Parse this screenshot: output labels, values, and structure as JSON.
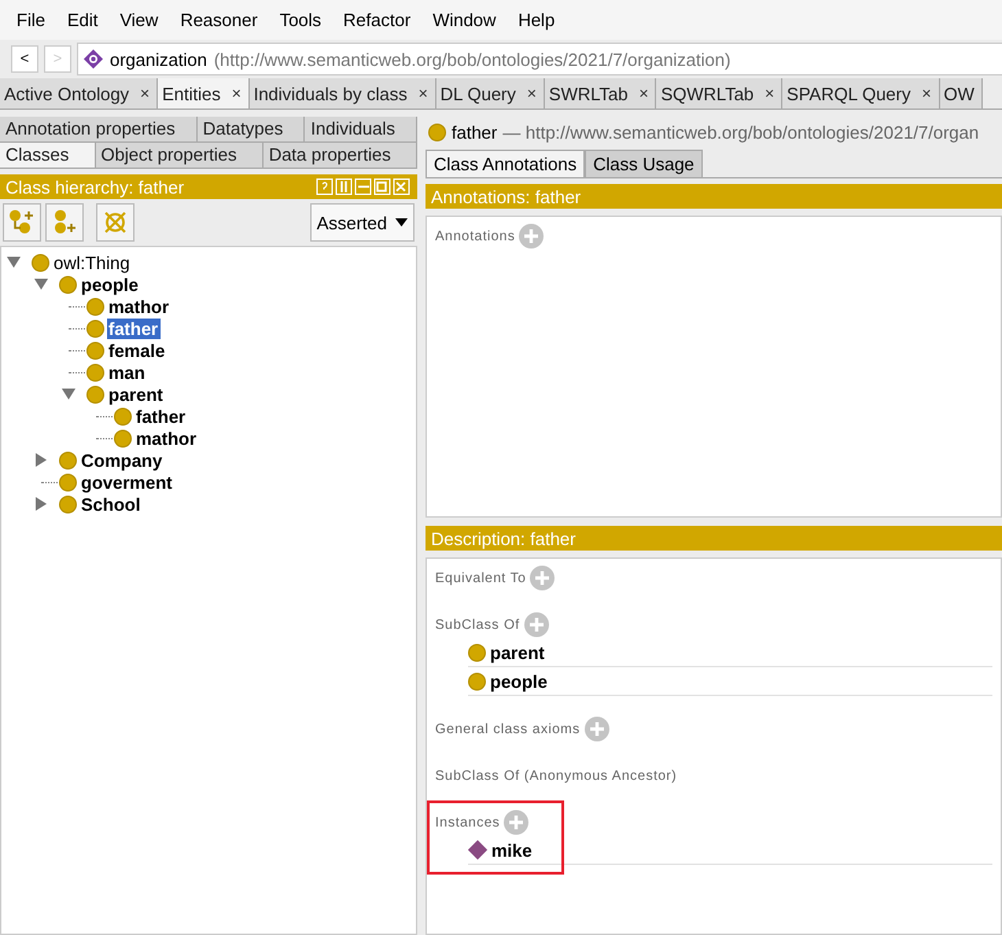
{
  "menu": [
    "File",
    "Edit",
    "View",
    "Reasoner",
    "Tools",
    "Refactor",
    "Window",
    "Help"
  ],
  "nav": {
    "back": "<",
    "forward": ">",
    "ontology": "organization",
    "iri": "(http://www.semanticweb.org/bob/ontologies/2021/7/organization)"
  },
  "tabs": [
    {
      "label": "Active Ontology",
      "selected": false,
      "close": "×"
    },
    {
      "label": "Entities",
      "selected": true,
      "close": "×"
    },
    {
      "label": "Individuals by class",
      "selected": false,
      "close": "×"
    },
    {
      "label": "DL Query",
      "selected": false,
      "close": "×"
    },
    {
      "label": "SWRLTab",
      "selected": false,
      "close": "×"
    },
    {
      "label": "SQWRLTab",
      "selected": false,
      "close": "×"
    },
    {
      "label": "SPARQL Query",
      "selected": false,
      "close": "×"
    },
    {
      "label": "OW",
      "selected": false
    }
  ],
  "entity_tab_rows": [
    [
      {
        "label": "Annotation properties",
        "selected": false
      },
      {
        "label": "Datatypes",
        "selected": false
      },
      {
        "label": "Individuals",
        "selected": false
      }
    ],
    [
      {
        "label": "Classes",
        "selected": true
      },
      {
        "label": "Object properties",
        "selected": false
      },
      {
        "label": "Data properties",
        "selected": false
      }
    ]
  ],
  "hierarchy": {
    "title": "Class hierarchy: father",
    "mode": "Asserted",
    "tree": [
      {
        "label": "owl:Thing",
        "bold": false,
        "selected": false,
        "expanded": true,
        "children": [
          {
            "label": "people",
            "bold": true,
            "selected": false,
            "expanded": true,
            "children": [
              {
                "label": "mathor",
                "bold": true,
                "selected": false
              },
              {
                "label": "father",
                "bold": true,
                "selected": true
              },
              {
                "label": "female",
                "bold": true,
                "selected": false
              },
              {
                "label": "man",
                "bold": true,
                "selected": false
              },
              {
                "label": "parent",
                "bold": true,
                "selected": false,
                "expanded": true,
                "children": [
                  {
                    "label": "father",
                    "bold": true,
                    "selected": false
                  },
                  {
                    "label": "mathor",
                    "bold": true,
                    "selected": false
                  }
                ]
              }
            ]
          },
          {
            "label": "Company",
            "bold": true,
            "selected": false,
            "expanded": false
          },
          {
            "label": "goverment",
            "bold": true,
            "selected": false
          },
          {
            "label": "School",
            "bold": true,
            "selected": false,
            "expanded": false
          }
        ]
      }
    ]
  },
  "entity": {
    "name": "father",
    "iri": "— http://www.semanticweb.org/bob/ontologies/2021/7/organ"
  },
  "entity_tabs": [
    {
      "label": "Class Annotations",
      "selected": true
    },
    {
      "label": "Class Usage",
      "selected": false
    }
  ],
  "annotations": {
    "title": "Annotations: father",
    "label": "Annotations"
  },
  "description": {
    "title": "Description: father",
    "sections": [
      {
        "title": "Equivalent To",
        "addable": true,
        "highlighted": false
      },
      {
        "title": "SubClass Of",
        "addable": true,
        "highlighted": false,
        "items": [
          {
            "kind": "class",
            "label": "parent"
          },
          {
            "kind": "class",
            "label": "people"
          }
        ]
      },
      {
        "title": "General class axioms",
        "addable": true,
        "highlighted": false
      },
      {
        "title": "SubClass Of (Anonymous Ancestor)",
        "addable": false,
        "highlighted": false
      },
      {
        "title": "Instances",
        "addable": true,
        "highlighted": true,
        "items": [
          {
            "kind": "individual",
            "label": "mike"
          }
        ]
      }
    ]
  }
}
